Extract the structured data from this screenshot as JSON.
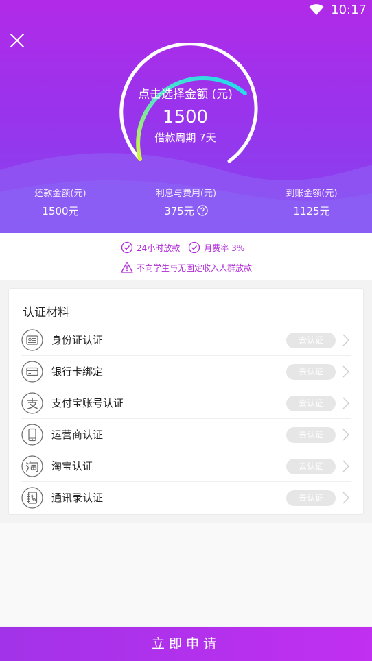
{
  "status_bar": {
    "time": "10:17",
    "icons": [
      "wifi-icon"
    ]
  },
  "header": {
    "close_icon": "close-icon"
  },
  "gauge": {
    "label": "点击选择金额 (元)",
    "amount": "1500",
    "period": "借款周期 7天",
    "colors": {
      "start": "#d6f53c",
      "middle": "#57e3c4",
      "end": "#20d9f0",
      "track": "#ffffff"
    }
  },
  "stats": [
    {
      "label": "还款金额(元)",
      "value": "1500元"
    },
    {
      "label": "利息与费用(元)",
      "value": "375元",
      "icon": "help-icon"
    },
    {
      "label": "到账金额(元)",
      "value": "1125元"
    }
  ],
  "notices": {
    "feature1": "24小时放款",
    "feature2": "月费率 3%",
    "warning": "不向学生与无固定收入人群放款",
    "accent": "#b02ad8"
  },
  "verification": {
    "title": "认证材料",
    "items": [
      {
        "label": "身份证认证",
        "action": "去认证",
        "icon": "id-card-icon"
      },
      {
        "label": "银行卡绑定",
        "action": "去认证",
        "icon": "bank-card-icon"
      },
      {
        "label": "支付宝账号认证",
        "action": "去认证",
        "icon": "alipay-icon"
      },
      {
        "label": "运营商认证",
        "action": "去认证",
        "icon": "phone-icon"
      },
      {
        "label": "淘宝认证",
        "action": "去认证",
        "icon": "taobao-icon"
      },
      {
        "label": "通讯录认证",
        "action": "去认证",
        "icon": "contacts-icon"
      }
    ]
  },
  "footer": {
    "apply_label": "立即申请",
    "color": "#b030ec"
  }
}
